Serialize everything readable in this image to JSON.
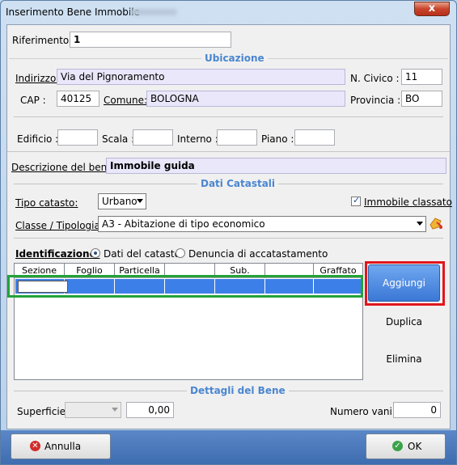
{
  "window": {
    "title": "Inserimento Bene Immobile",
    "close_glyph": "x"
  },
  "riferimento": {
    "label": "Riferimento:",
    "value": "1"
  },
  "ubicazione": {
    "section_title": "Ubicazione",
    "indirizzo_label": "Indirizzo:",
    "indirizzo_value": "Via del Pignoramento",
    "ncivico_label": "N. Civico :",
    "ncivico_value": "11",
    "cap_label": "CAP :",
    "cap_value": "40125",
    "comune_label": "Comune:",
    "comune_value": "BOLOGNA",
    "provincia_label": "Provincia :",
    "provincia_value": "BO",
    "edificio_label": "Edificio :",
    "scala_label": "Scala :",
    "interno_label": "Interno :",
    "piano_label": "Piano :"
  },
  "descrizione": {
    "label": "Descrizione del bene:",
    "value": "Immobile guida"
  },
  "dati_catastali": {
    "section_title": "Dati Catastali",
    "tipo_label": "Tipo catasto:",
    "tipo_value": "Urbano",
    "classato_label": "Immobile classato",
    "classato_checked": true,
    "classe_label": "Classe / Tipologia:",
    "classe_value": "A3 - Abitazione di tipo economico",
    "identificazione_label": "Identificazione:",
    "radio_dati": "Dati del catasto",
    "radio_denuncia": "Denuncia di accatastamento",
    "selected_radio": "Dati del catasto"
  },
  "grid": {
    "columns": [
      "Sezione",
      "Foglio",
      "Particella",
      "",
      "Sub.",
      "",
      "Graffato"
    ]
  },
  "actions": {
    "aggiungi": "Aggiungi",
    "duplica": "Duplica",
    "elimina": "Elimina"
  },
  "dettagli": {
    "section_title": "Dettagli del Bene",
    "superficie_label": "Superficie:",
    "superficie_value": "0,00",
    "vani_label": "Numero vani:",
    "vani_value": "0"
  },
  "footer": {
    "annulla": "Annulla",
    "ok": "OK"
  },
  "colors": {
    "accent": "#4a86d0",
    "selection": "#3d7fe8",
    "highlight_red": "#e0161d",
    "highlight_green": "#23a23a"
  }
}
